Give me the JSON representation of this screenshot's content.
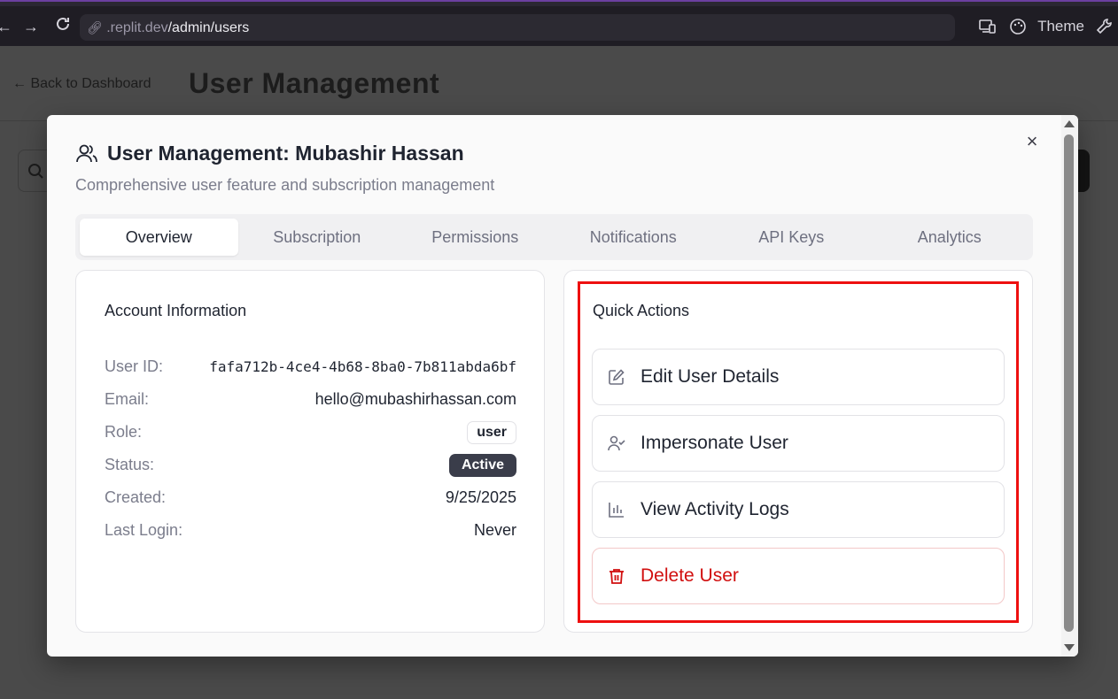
{
  "browser": {
    "url_host": ".replit.dev",
    "url_path": "/admin/users",
    "theme_label": "Theme"
  },
  "page": {
    "back_label": "← Back to Dashboard",
    "title": "User Management"
  },
  "modal": {
    "title": "User Management: Mubashir Hassan",
    "subtitle": "Comprehensive user feature and subscription management",
    "close_label": "×",
    "tabs": [
      {
        "label": "Overview",
        "active": true
      },
      {
        "label": "Subscription",
        "active": false
      },
      {
        "label": "Permissions",
        "active": false
      },
      {
        "label": "Notifications",
        "active": false
      },
      {
        "label": "API Keys",
        "active": false
      },
      {
        "label": "Analytics",
        "active": false
      }
    ],
    "account": {
      "heading": "Account Information",
      "rows": [
        {
          "label": "User ID:",
          "value": "fafa712b-4ce4-4b68-8ba0-7b811abda6bf"
        },
        {
          "label": "Email:",
          "value": "hello@mubashirhassan.com"
        },
        {
          "label": "Role:",
          "value": "user"
        },
        {
          "label": "Status:",
          "value": "Active"
        },
        {
          "label": "Created:",
          "value": "9/25/2025"
        },
        {
          "label": "Last Login:",
          "value": "Never"
        }
      ]
    },
    "quick_actions": {
      "heading": "Quick Actions",
      "items": [
        {
          "label": "Edit User Details",
          "icon": "edit-icon"
        },
        {
          "label": "Impersonate User",
          "icon": "user-check-icon"
        },
        {
          "label": "View Activity Logs",
          "icon": "bar-chart-icon"
        },
        {
          "label": "Delete User",
          "icon": "trash-icon"
        }
      ]
    }
  },
  "colors": {
    "danger": "#d10f0f",
    "highlight": "#ee1010",
    "badge_active": "#3a3d4a"
  }
}
